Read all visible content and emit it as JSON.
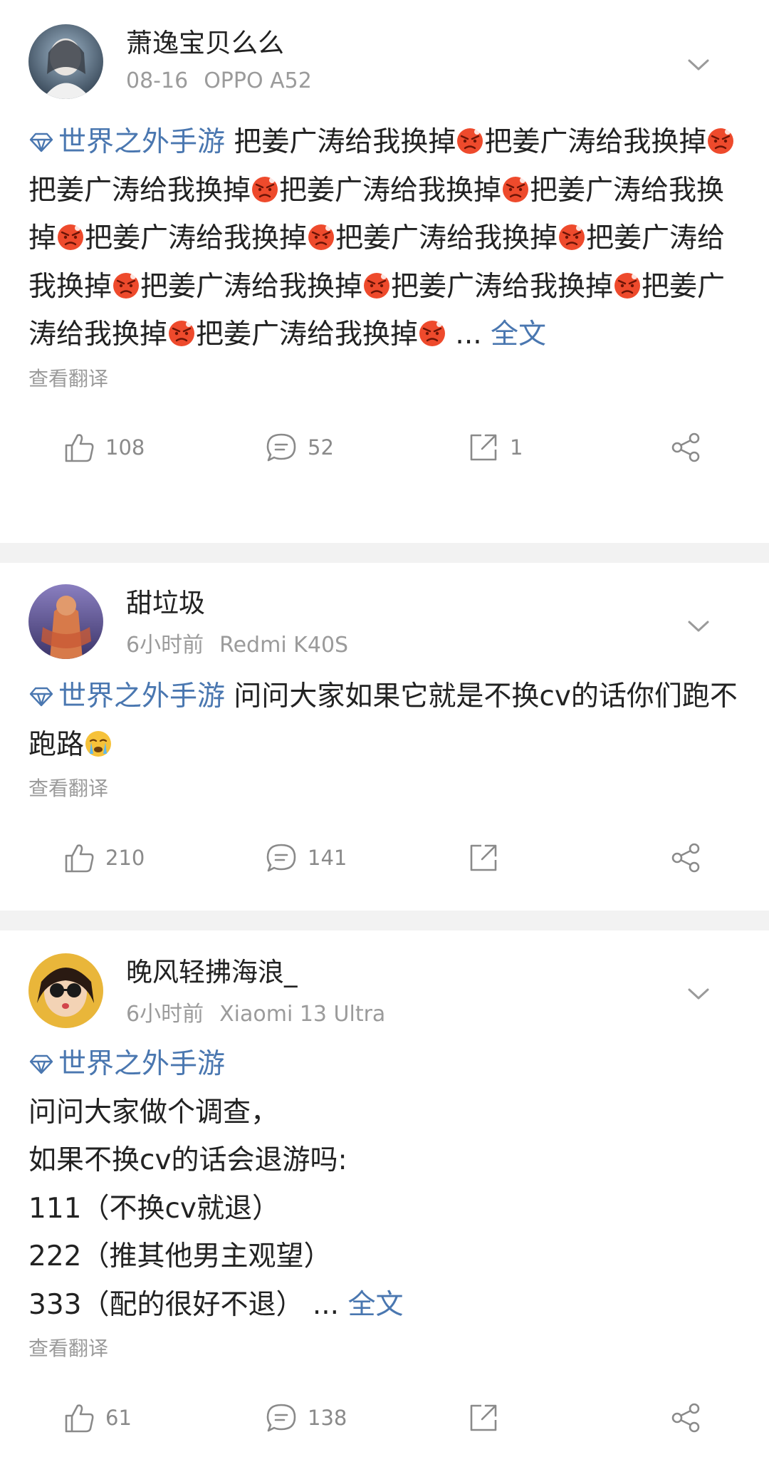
{
  "posts": [
    {
      "username": "萧逸宝贝么么",
      "date": "08-16",
      "device": "OPPO A52",
      "topic": "世界之外手游",
      "body_prefix": " 把姜广涛给我换掉",
      "repeat_text": "把姜广涛给我换掉",
      "ellipsis": " ...",
      "more": " 全文",
      "translate": "查看翻译",
      "likes": "108",
      "comments": "52",
      "reposts": "1"
    },
    {
      "username": "甜垃圾",
      "date": "6小时前",
      "device": "Redmi K40S",
      "topic": "世界之外手游",
      "body": " 问问大家如果它就是不换cv的话你们跑不跑路",
      "translate": "查看翻译",
      "likes": "210",
      "comments": "141",
      "reposts": ""
    },
    {
      "username": "晚风轻拂海浪_",
      "date": "6小时前",
      "device": "Xiaomi 13 Ultra",
      "topic": "世界之外手游",
      "lines": [
        "问问大家做个调查，",
        "如果不换cv的话会退游吗:",
        "111（不换cv就退）",
        "222（推其他男主观望）"
      ],
      "last_line": "333（配的很好不退）",
      "ellipsis": " ...",
      "more": " 全文",
      "translate": "查看翻译",
      "likes": "61",
      "comments": "138",
      "reposts": ""
    }
  ],
  "colors": {
    "link": "#4a77b0",
    "meta": "#9b9b9b",
    "separator": "#f2f2f2"
  },
  "icons": [
    "like-icon",
    "comment-icon",
    "repost-icon",
    "share-icon",
    "chevron-down-icon",
    "topic-gem-icon",
    "angry-emoji-icon",
    "crying-emoji-icon"
  ]
}
